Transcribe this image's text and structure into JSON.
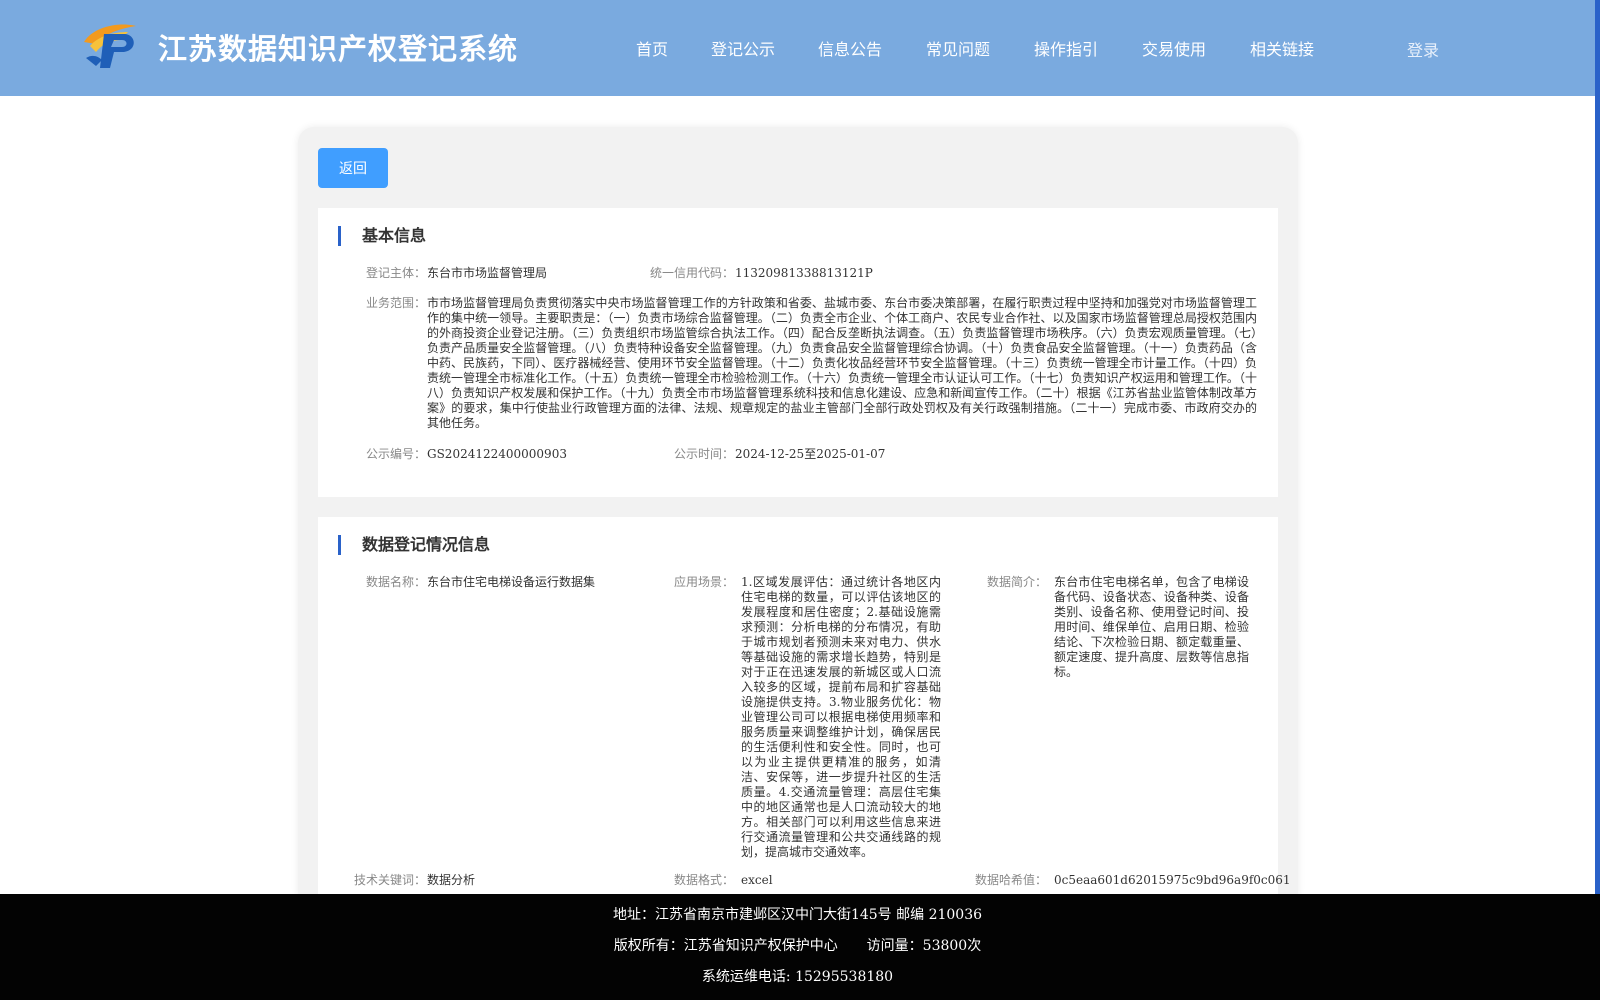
{
  "header": {
    "title": "江苏数据知识产权登记系统",
    "nav": [
      "首页",
      "登记公示",
      "信息公告",
      "常见问题",
      "操作指引",
      "交易使用",
      "相关链接"
    ],
    "login_label": "登录"
  },
  "colors": {
    "header_bg": "#7aaadf",
    "accent": "#409eff",
    "section_bar": "#2a62c9",
    "footer_bg": "#030303"
  },
  "back_label": "返回",
  "basic": {
    "title": "基本信息",
    "entity_label": "登记主体：",
    "entity_value": "东台市市场监督管理局",
    "credit_label": "统一信用代码：",
    "credit_value": "11320981338813121P",
    "scope_label": "业务范围：",
    "scope_value": "市市场监督管理局负责贯彻落实中央市场监督管理工作的方针政策和省委、盐城市委、东台市委决策部署，在履行职责过程中坚持和加强党对市场监督管理工作的集中统一领导。主要职责是：（一）负责市场综合监督管理。（二）负责全市企业、个体工商户、农民专业合作社、以及国家市场监督管理总局授权范围内的外商投资企业登记注册。（三）负责组织市场监管综合执法工作。（四）配合反垄断执法调查。（五）负责监督管理市场秩序。（六）负责宏观质量管理。（七）负责产品质量安全监督管理。（八）负责特种设备安全监督管理。（九）负责食品安全监督管理综合协调。（十）负责食品安全监督管理。（十一）负责药品（含中药、民族药，下同）、医疗器械经营、使用环节安全监督管理。（十二）负责化妆品经营环节安全监督管理。（十三）负责统一管理全市计量工作。（十四）负责统一管理全市标准化工作。（十五）负责统一管理全市检验检测工作。（十六）负责统一管理全市认证认可工作。（十七）负责知识产权运用和管理工作。（十八）负责知识产权发展和保护工作。（十九）负责全市市场监督管理系统科技和信息化建设、应急和新闻宣传工作。（二十）根据《江苏省盐业监管体制改革方案》的要求，集中行使盐业行政管理方面的法律、法规、规章规定的盐业主管部门全部行政处罚权及有关行政强制措施。（二十一）完成市委、市政府交办的其他任务。",
    "code_label": "公示编号：",
    "code_value": "GS2024122400000903",
    "time_label": "公示时间：",
    "time_value": "2024-12-25至2025-01-07"
  },
  "data_reg": {
    "title": "数据登记情况信息",
    "name_label": "数据名称：",
    "name_value": "东台市住宅电梯设备运行数据集",
    "scene_label": "应用场景：",
    "scene_value": "1.区域发展评估：通过统计各地区内住宅电梯的数量，可以评估该地区的发展程度和居住密度；2.基础设施需求预测：分析电梯的分布情况，有助于城市规划者预测未来对电力、供水等基础设施的需求增长趋势，特别是对于正在迅速发展的新城区或人口流入较多的区域，提前布局和扩容基础设施提供支持。3.物业服务优化：物业管理公司可以根据电梯使用频率和服务质量来调整维护计划，确保居民的生活便利性和安全性。同时，也可以为业主提供更精准的服务，如清洁、安保等，进一步提升社区的生活质量。4.交通流量管理：高层住宅集中的地区通常也是人口流动较大的地方。相关部门可以利用这些信息来进行交通流量管理和公共交通线路的规划，提高城市交通效率。",
    "intro_label": "数据简介：",
    "intro_value": "东台市住宅电梯名单，包含了电梯设备代码、设备状态、设备种类、设备类别、设备名称、使用登记时间、投用时间、维保单位、启用日期、检验结论、下次检验日期、额定载重量、额定速度、提升高度、层数等信息指标。",
    "keyword_label": "技术关键词：",
    "keyword_value": "数据分析",
    "format_label": "数据格式：",
    "format_value": "excel",
    "hash_label": "数据哈希值：",
    "hash_value": "0c5eaa601d62015975c9bd96a9f0c061"
  },
  "footer": {
    "address": "地址：江苏省南京市建邺区汉中门大街145号 邮编 210036",
    "copyright": "版权所有：江苏省知识产权保护中心",
    "visits": "访问量：53800次",
    "phone": "系统运维电话: 15295538180"
  }
}
